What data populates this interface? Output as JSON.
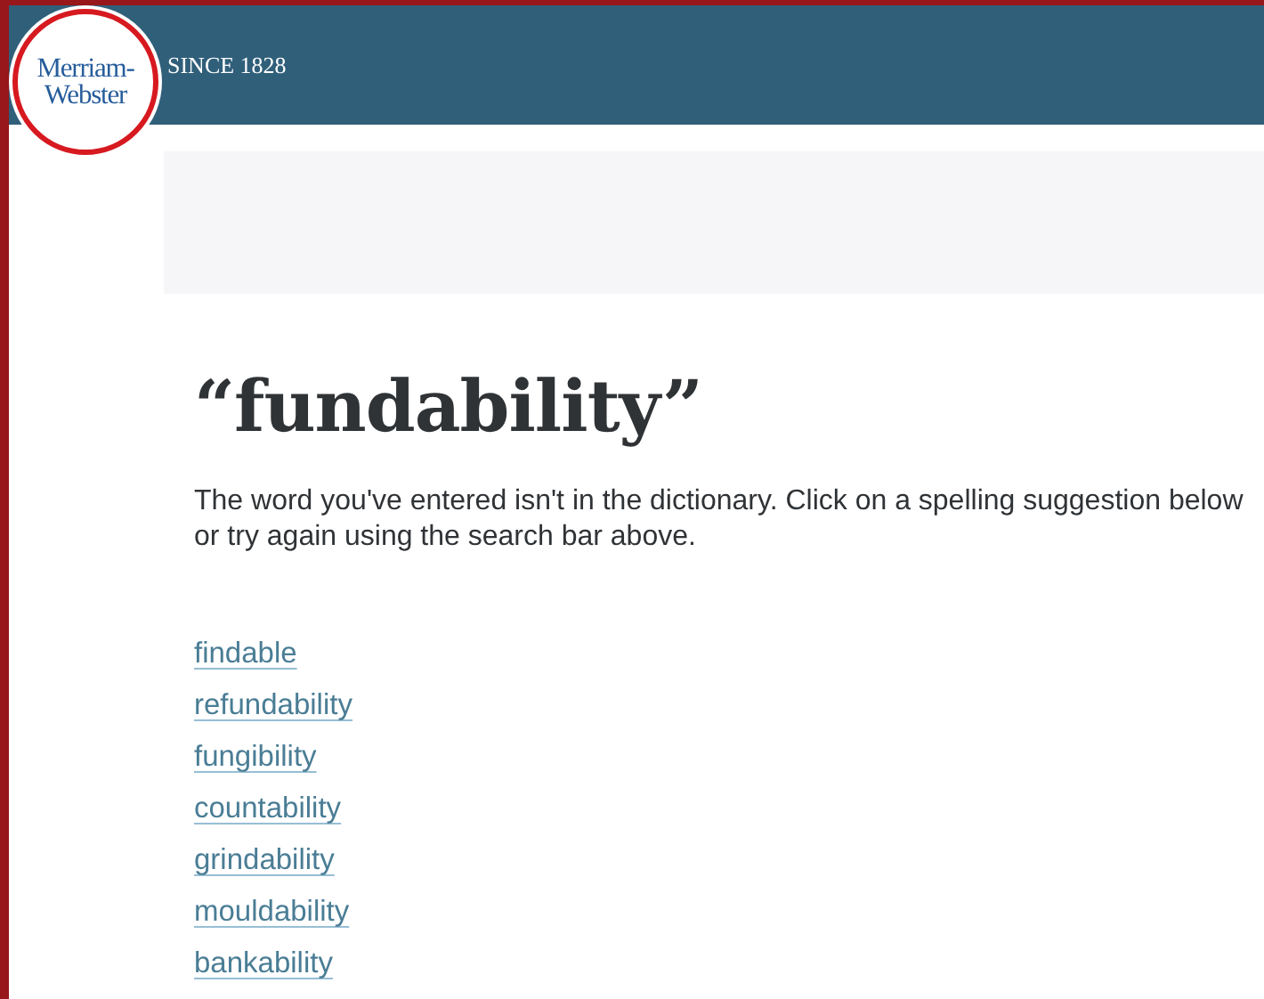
{
  "header": {
    "logo_lines": [
      "Merriam-",
      "Webster"
    ],
    "tagline": "SINCE 1828"
  },
  "word": "“fundability”",
  "message": "The word you've entered isn't in the dictionary. Click on a spelling suggestion below or try again using the search bar above.",
  "suggestions": [
    "findable",
    "refundability",
    "fungibility",
    "countability",
    "grindability",
    "mouldability",
    "bankability"
  ]
}
